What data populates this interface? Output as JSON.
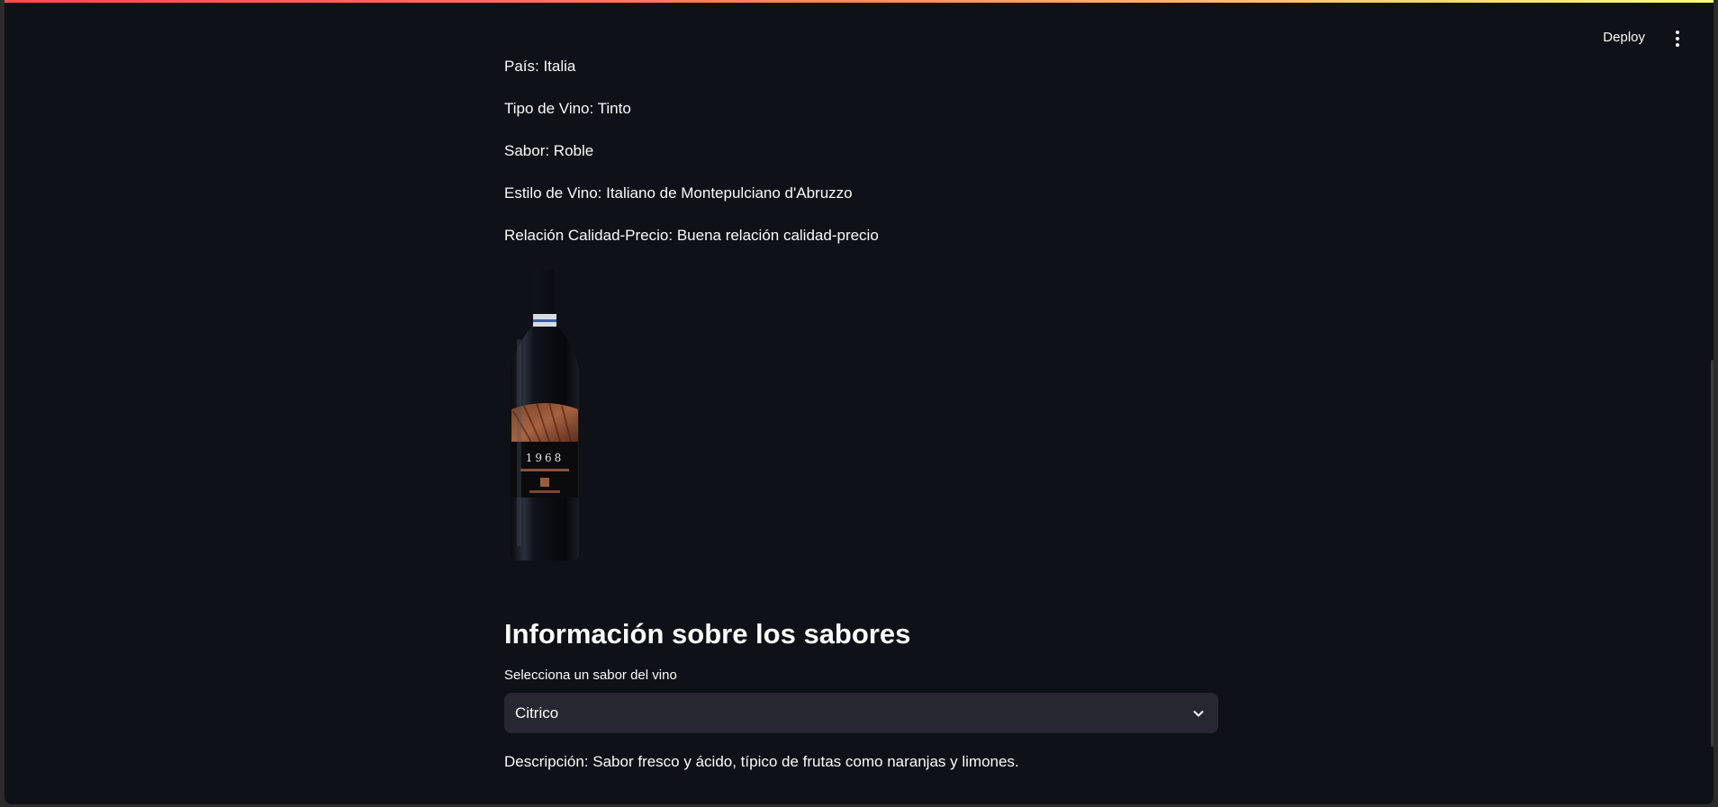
{
  "header": {
    "deploy_label": "Deploy",
    "menu_icon": "kebab-menu-icon"
  },
  "wine": {
    "country": "País: Italia",
    "type": "Tipo de Vino: Tinto",
    "flavor": "Sabor: Roble",
    "style": "Estilo de Vino: Italiano de Montepulciano d'Abruzzo",
    "value": "Relación Calidad-Precio: Buena relación calidad-precio",
    "bottle_label": "1968"
  },
  "flavors": {
    "heading": "Información sobre los sabores",
    "select_label": "Selecciona un sabor del vino",
    "selected": "Citrico",
    "description": "Descripción: Sabor fresco y ácido, típico de frutas como naranjas y limones."
  },
  "colors": {
    "background": "#0e1117",
    "select_bg": "#262730",
    "accent": "#ff4b4b"
  }
}
